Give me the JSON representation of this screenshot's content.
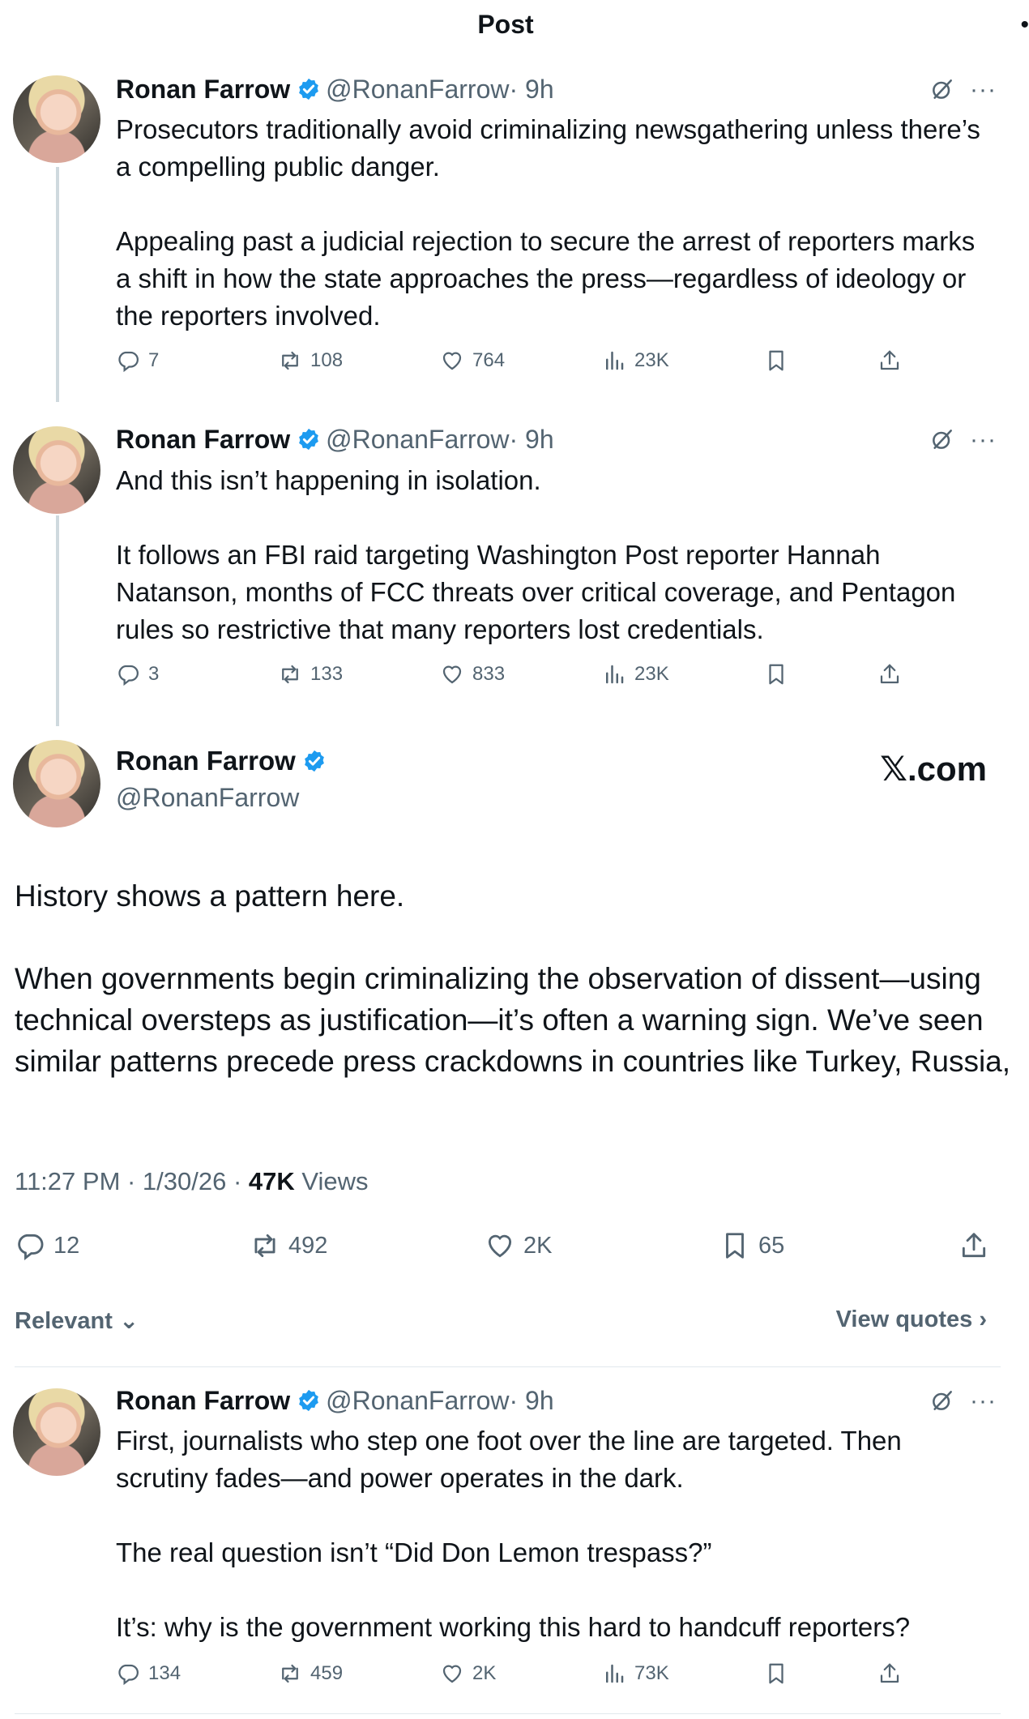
{
  "header": {
    "title": "Post",
    "dot": "•"
  },
  "replies_above": [
    {
      "name": "Ronan Farrow",
      "handle": "@RonanFarrow",
      "time": "· 9h",
      "paragraphs": [
        "Prosecutors traditionally avoid criminalizing newsgathering unless there’s a compelling public danger.",
        "Appealing past a judicial rejection to secure the arrest of reporters marks a shift in how the state approaches the press—regardless of ideology or the reporters involved."
      ],
      "stats": {
        "replies": "7",
        "reposts": "108",
        "likes": "764",
        "views": "23K"
      }
    },
    {
      "name": "Ronan Farrow",
      "handle": "@RonanFarrow",
      "time": "· 9h",
      "paragraphs": [
        "And this isn’t happening in isolation.",
        "It follows an FBI raid targeting Washington Post reporter Hannah Natanson, months of FCC threats over critical coverage, and Pentagon rules so restrictive that many reporters lost credentials."
      ],
      "stats": {
        "replies": "3",
        "reposts": "133",
        "likes": "833",
        "views": "23K"
      }
    }
  ],
  "main": {
    "name": "Ronan Farrow",
    "handle": "@RonanFarrow",
    "watermark": "𝕏.com",
    "paragraphs": [
      "History shows a pattern here.",
      "When governments begin criminalizing the observation of dissent—using technical oversteps as justification—it’s often a warning sign. We’ve seen similar patterns precede press crackdowns in countries like Turkey, Russia,"
    ],
    "timestamp": "11:27 PM · 1/30/26 · ",
    "views_count": "47K",
    "views_label": " Views",
    "stats": {
      "replies": "12",
      "reposts": "492",
      "likes": "2K",
      "bookmarks": "65"
    }
  },
  "filters": {
    "relevant": "Relevant",
    "view_quotes": "View quotes"
  },
  "reply_below": {
    "name": "Ronan Farrow",
    "handle": "@RonanFarrow",
    "time": "· 9h",
    "paragraphs": [
      "First, journalists who step one foot over the line are targeted. Then scrutiny fades—and power operates in the dark.",
      "The real question isn’t “Did Don Lemon trespass?”",
      "It’s: why is the government working this hard to handcuff reporters?"
    ],
    "stats": {
      "replies": "134",
      "reposts": "459",
      "likes": "2K",
      "views": "73K"
    }
  },
  "colors": {
    "verified": "#1d9bf0",
    "secondary": "#536471",
    "text": "#0f1419",
    "thread_line": "#cfd9de"
  }
}
